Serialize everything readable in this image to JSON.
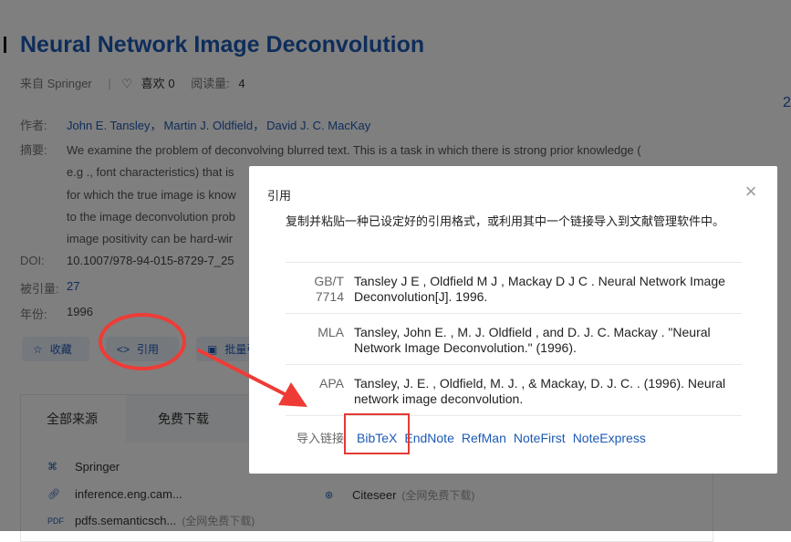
{
  "article": {
    "title": "Neural Network Image Deconvolution",
    "source_prefix": "来自 Springer",
    "likes_label": "喜欢",
    "likes_count": "0",
    "reads_label": "阅读量:",
    "reads_count": "4"
  },
  "fields": {
    "authors_label": "作者:",
    "authors": [
      "John E. Tansley，",
      "Martin J. Oldfield，",
      "David J. C. MacKay"
    ],
    "abstract_label": "摘要:",
    "abstract_lines": [
      "We examine the problem of deconvolving blurred text. This is a task in which there is strong prior knowledge (",
      "e.g ., font characteristics) that is",
      "for which the true image is know",
      "to the image deconvolution prob",
      "image positivity can be hard-wir"
    ],
    "doi_label": "DOI:",
    "doi": "10.1007/978-94-015-8729-7_25",
    "cited_label": "被引量:",
    "cited": "27",
    "year_label": "年份:",
    "year": "1996"
  },
  "actions": {
    "favorite": "收藏",
    "cite": "引用",
    "batch": "批量引"
  },
  "sources": {
    "tabs": [
      "全部来源",
      "免费下载"
    ],
    "items": [
      {
        "name": "Springer",
        "note": ""
      },
      {
        "name": "inference.eng.cam...",
        "note": ""
      },
      {
        "name": "pdfs.semanticsch...",
        "note": "(全网免费下载)"
      }
    ],
    "citeseer": {
      "name": "Citeseer",
      "note": "(全网免费下载)"
    }
  },
  "right_side": {
    "partial_char": "2"
  },
  "modal": {
    "title": "引用",
    "description": "复制并粘贴一种已设定好的引用格式，或利用其中一个链接导入到文献管理软件中。",
    "citations": [
      {
        "format_line1": "GB/T",
        "format_line2": "7714",
        "text": "Tansley J E , Oldfield M J , Mackay D J C . Neural Network Image Deconvolution[J]. 1996."
      },
      {
        "format_line1": "MLA",
        "format_line2": "",
        "text": "Tansley, John E. , M. J. Oldfield , and D. J. C. Mackay . \"Neural Network Image Deconvolution.\" (1996)."
      },
      {
        "format_line1": "APA",
        "format_line2": "",
        "text": "Tansley, J. E. , Oldfield, M. J. , & Mackay, D. J. C. . (1996). Neural network image deconvolution."
      }
    ],
    "import_label": "导入链接",
    "import_links": [
      "BibTeX",
      "EndNote",
      "RefMan",
      "NoteFirst",
      "NoteExpress"
    ]
  },
  "colors": {
    "link": "#1d5ab5",
    "annotation_red": "#e53935",
    "overlay": "rgba(0,0,0,0.5)"
  }
}
